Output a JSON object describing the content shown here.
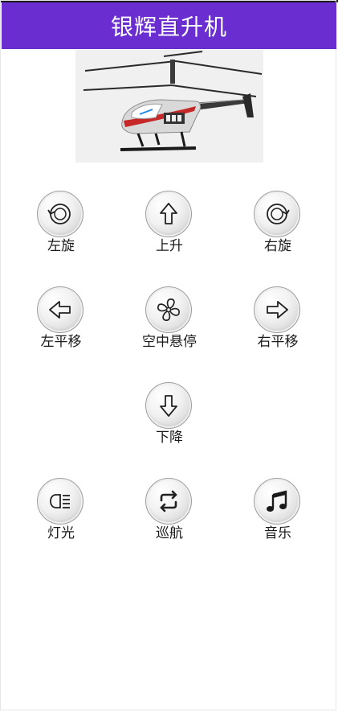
{
  "app": {
    "title": "银辉直升机"
  },
  "hero": {
    "image_icon": "helicopter-image"
  },
  "controls": {
    "left_spin": {
      "label": "左旋",
      "icon": "rotate-left-icon"
    },
    "ascend": {
      "label": "上升",
      "icon": "arrow-up-icon"
    },
    "right_spin": {
      "label": "右旋",
      "icon": "rotate-right-icon"
    },
    "left_move": {
      "label": "左平移",
      "icon": "arrow-left-icon"
    },
    "hover": {
      "label": "空中悬停",
      "icon": "fan-icon"
    },
    "right_move": {
      "label": "右平移",
      "icon": "arrow-right-icon"
    },
    "descend": {
      "label": "下降",
      "icon": "arrow-down-icon"
    },
    "light": {
      "label": "灯光",
      "icon": "headlight-icon"
    },
    "cruise": {
      "label": "巡航",
      "icon": "loop-icon"
    },
    "music": {
      "label": "音乐",
      "icon": "music-note-icon"
    }
  },
  "colors": {
    "titlebar": "#6a2ed0",
    "button_border": "#9e9e9e"
  }
}
